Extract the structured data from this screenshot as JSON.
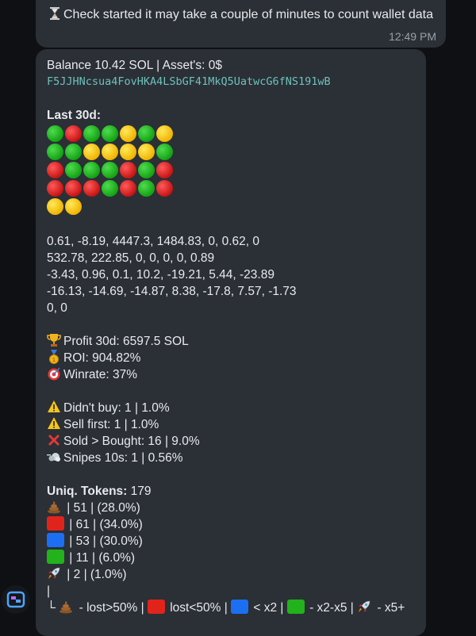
{
  "top_message": {
    "text": "Check started it may take a couple of minutes to count wallet data",
    "time": "12:49 PM"
  },
  "report": {
    "balance_line": "Balance 10.42 SOL | Asset's: 0$",
    "wallet_address": "F5JJHNcsua4FovHKA4LSbGF41MkQ5UatwcG6fNS191wB",
    "last30d_label": "Last 30d:",
    "dot_rows": [
      [
        "green",
        "red",
        "green",
        "green",
        "yellow",
        "green",
        "yellow"
      ],
      [
        "green",
        "green",
        "yellow",
        "yellow",
        "yellow",
        "yellow",
        "green"
      ],
      [
        "red",
        "green",
        "green",
        "green",
        "red",
        "green",
        "red"
      ],
      [
        "red",
        "red",
        "red",
        "green",
        "red",
        "green",
        "red"
      ],
      [
        "yellow",
        "yellow"
      ]
    ],
    "values_lines": [
      "0.61, -8.19, 4447.3, 1484.83, 0, 0.62, 0",
      "532.78, 222.85, 0, 0, 0, 0, 0.89",
      "-3.43, 0.96, 0.1, 10.2, -19.21, 5.44, -23.89",
      "-16.13, -14.69, -14.87, 8.38, -17.8, 7.57, -1.73",
      "0, 0"
    ],
    "profit": "Profit 30d: 6597.5 SOL",
    "roi": "ROI: 904.82%",
    "winrate": "Winrate: 37%",
    "didnt_buy": "Didn't buy: 1 | 1.0%",
    "sell_first": "Sell first: 1 | 1.0%",
    "sold_bought": "Sold > Bought: 16 | 9.0%",
    "snipes": "Snipes 10s: 1 | 0.56%",
    "uniq_label": "Uniq. Tokens:",
    "uniq_value": " 179",
    "token_rows": [
      {
        "icon": "poop-icon",
        "text": " | 51 | (28.0%)"
      },
      {
        "icon": "red-square-icon",
        "text": " | 61 | (34.0%)"
      },
      {
        "icon": "blue-square-icon",
        "text": " | 53 | (30.0%)"
      },
      {
        "icon": "green-square-icon",
        "text": " | 11 | (6.0%)"
      },
      {
        "icon": "rocket-icon",
        "text": " | 2 | (1.0%)"
      }
    ],
    "pipe": "|",
    "legend": {
      "corner": "└",
      "lost_gt50": " - lost>50% |",
      "lost_lt50": " lost<50% |",
      "lt_x2": " < x2 |",
      "x2_x5": " - x2-x5 |",
      "x5_plus": " - x5+"
    }
  },
  "colors": {
    "bubble": "#2b2f36",
    "background": "#0e1013",
    "address": "#6cc2bb",
    "time": "#9aa0a6"
  }
}
